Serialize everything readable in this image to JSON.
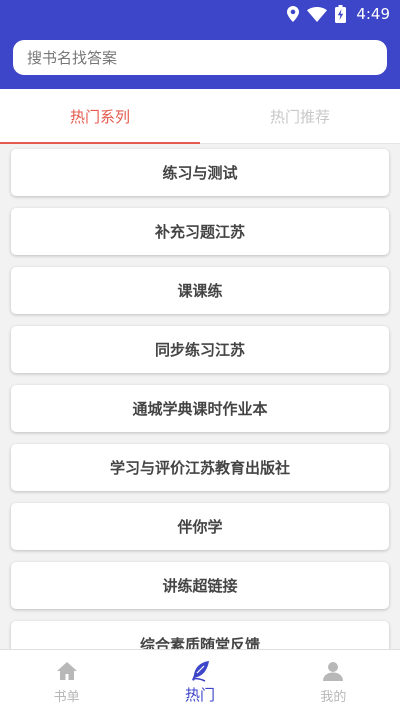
{
  "status_bar": {
    "time": "4:49",
    "icons": [
      "location-icon",
      "wifi-icon",
      "battery-charging-icon"
    ]
  },
  "search": {
    "placeholder": "搜书名找答案",
    "value": ""
  },
  "tabs": [
    {
      "label": "热门系列",
      "active": true
    },
    {
      "label": "热门推荐",
      "active": false
    }
  ],
  "series_list": [
    "练习与测试",
    "补充习题江苏",
    "课课练",
    "同步练习江苏",
    "通城学典课时作业本",
    "学习与评价江苏教育出版社",
    "伴你学",
    "讲练超链接",
    "综合素质随堂反馈"
  ],
  "bottom_nav": [
    {
      "label": "书单",
      "icon": "home-icon",
      "active": false
    },
    {
      "label": "热门",
      "icon": "feather-icon",
      "active": true
    },
    {
      "label": "我的",
      "icon": "user-icon",
      "active": false
    }
  ],
  "colors": {
    "header": "#3d45c8",
    "tab_active": "#e55a4e",
    "tab_inactive": "#c8c8c8",
    "nav_active": "#3d45c8",
    "nav_inactive": "#b8b8b8"
  }
}
